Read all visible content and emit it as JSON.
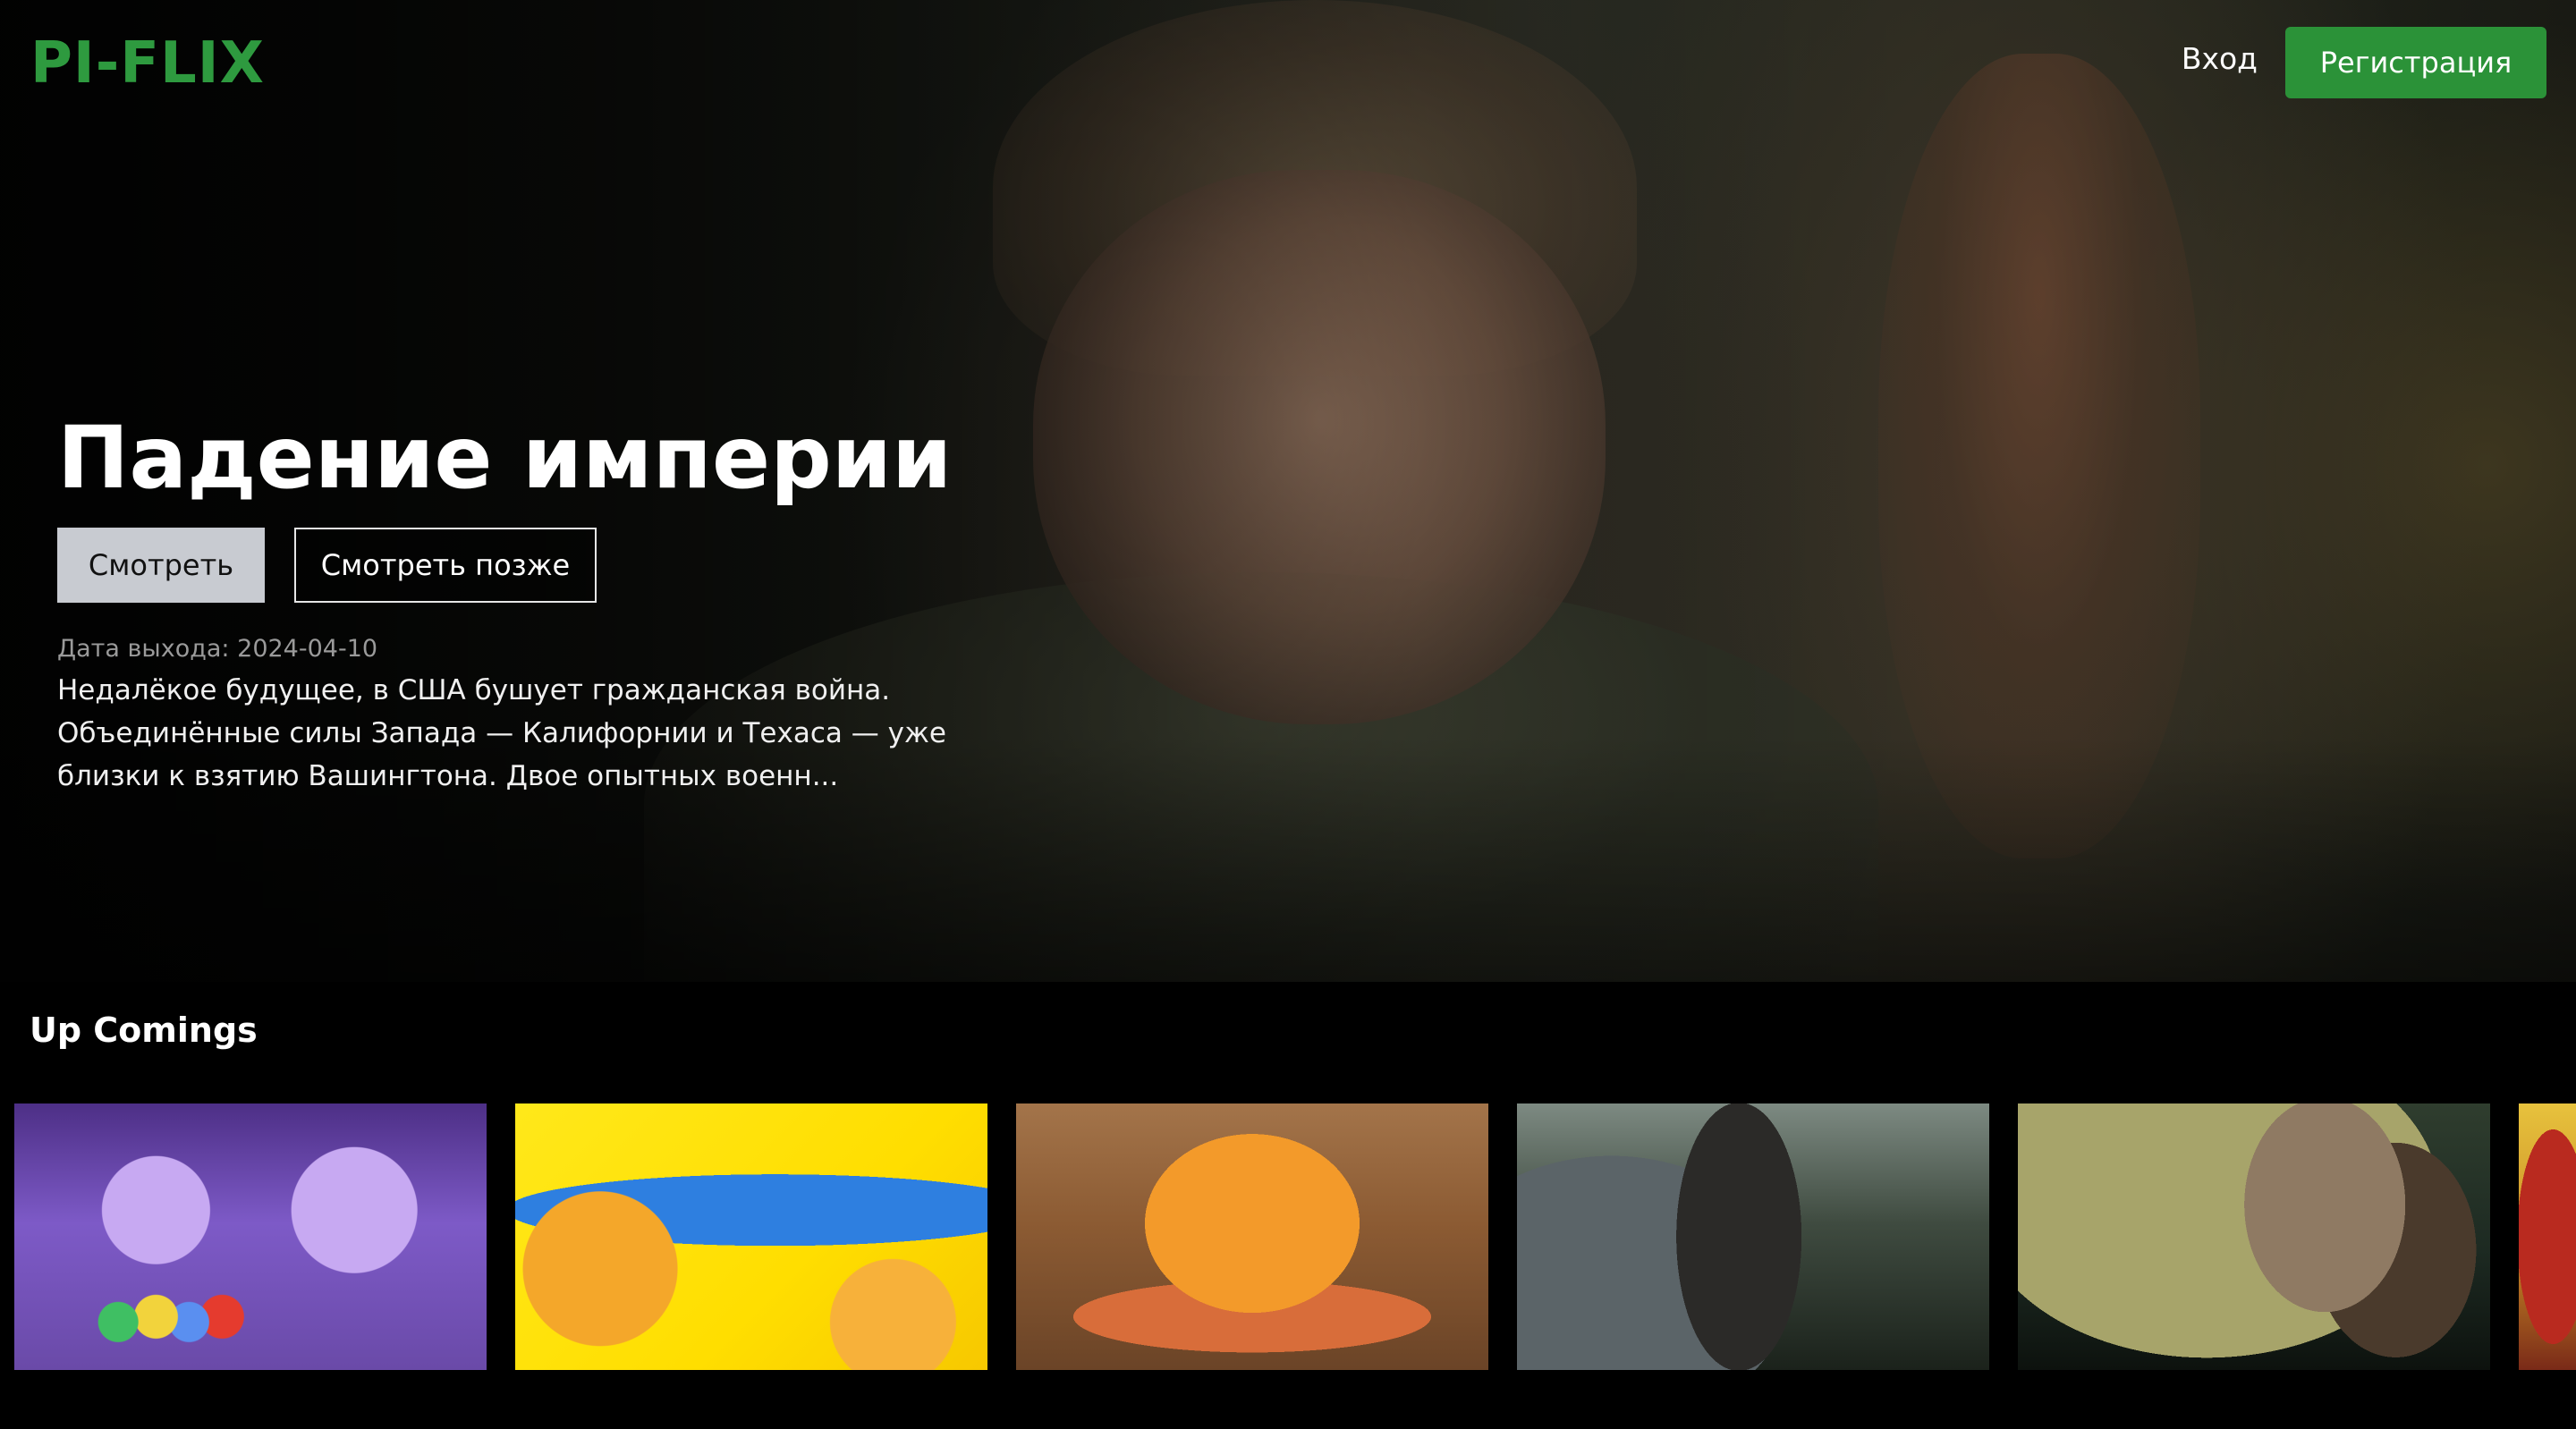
{
  "header": {
    "logo": "PI-FLIX",
    "login_label": "Вход",
    "register_label": "Регистрация"
  },
  "hero": {
    "title": "Падение империи",
    "watch_label": "Смотреть",
    "watch_later_label": "Смотреть позже",
    "release_label": "Дата выхода:",
    "release_date": "2024-04-10",
    "overview": "Недалёкое будущее, в США бушует гражданская война. Объединённые силы Запада — Калифорнии и Техаса — уже близки к взятию Вашингтона. Двое опытных военн..."
  },
  "upcoming": {
    "title": "Up Comings",
    "items": [
      "poster-1",
      "poster-2",
      "poster-3",
      "poster-4",
      "poster-5",
      "poster-6"
    ]
  },
  "colors": {
    "brand": "#2e9a3f",
    "register_button": "#2b9238",
    "watch_button": "#c8cbd1",
    "background": "#000000"
  }
}
